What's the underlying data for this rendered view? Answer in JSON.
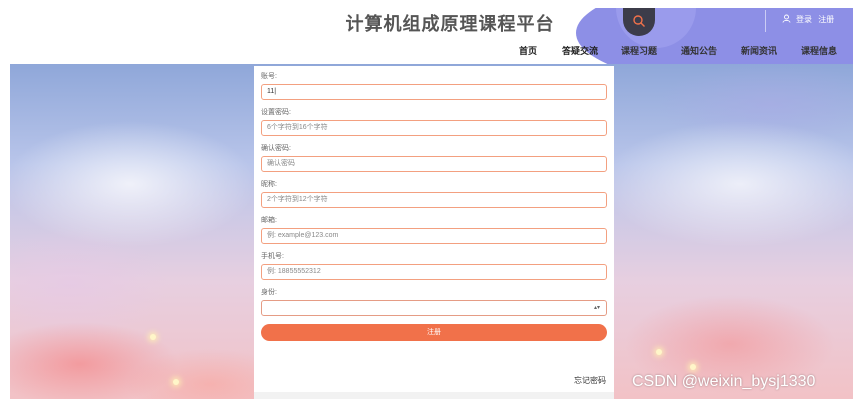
{
  "header": {
    "title": "计算机组成原理课程平台",
    "auth": {
      "login": "登录",
      "register": "注册"
    },
    "nav": [
      "首页",
      "答疑交流",
      "课程习题",
      "通知公告",
      "新闻资讯",
      "课程信息"
    ]
  },
  "form": {
    "fields": [
      {
        "label": "账号:",
        "value": "11|",
        "placeholder": ""
      },
      {
        "label": "设置密码:",
        "value": "",
        "placeholder": "6个字符到16个字符"
      },
      {
        "label": "确认密码:",
        "value": "",
        "placeholder": "确认密码"
      },
      {
        "label": "昵称:",
        "value": "",
        "placeholder": "2个字符到12个字符"
      },
      {
        "label": "邮箱:",
        "value": "",
        "placeholder": "例: example@123.com"
      },
      {
        "label": "手机号:",
        "value": "",
        "placeholder": "例: 18855552312"
      }
    ],
    "identity": {
      "label": "身份:",
      "selected": ""
    },
    "submit_label": "注册",
    "forgot_label": "忘记密码"
  },
  "watermark": "CSDN @weixin_bysj1330",
  "colors": {
    "accent": "#f1714a",
    "header_blob": "#8d8fe6",
    "search_bg": "#3c3c4a"
  },
  "icons": {
    "search": "search-icon",
    "user": "user-icon",
    "select": "chevron-updown-icon"
  }
}
